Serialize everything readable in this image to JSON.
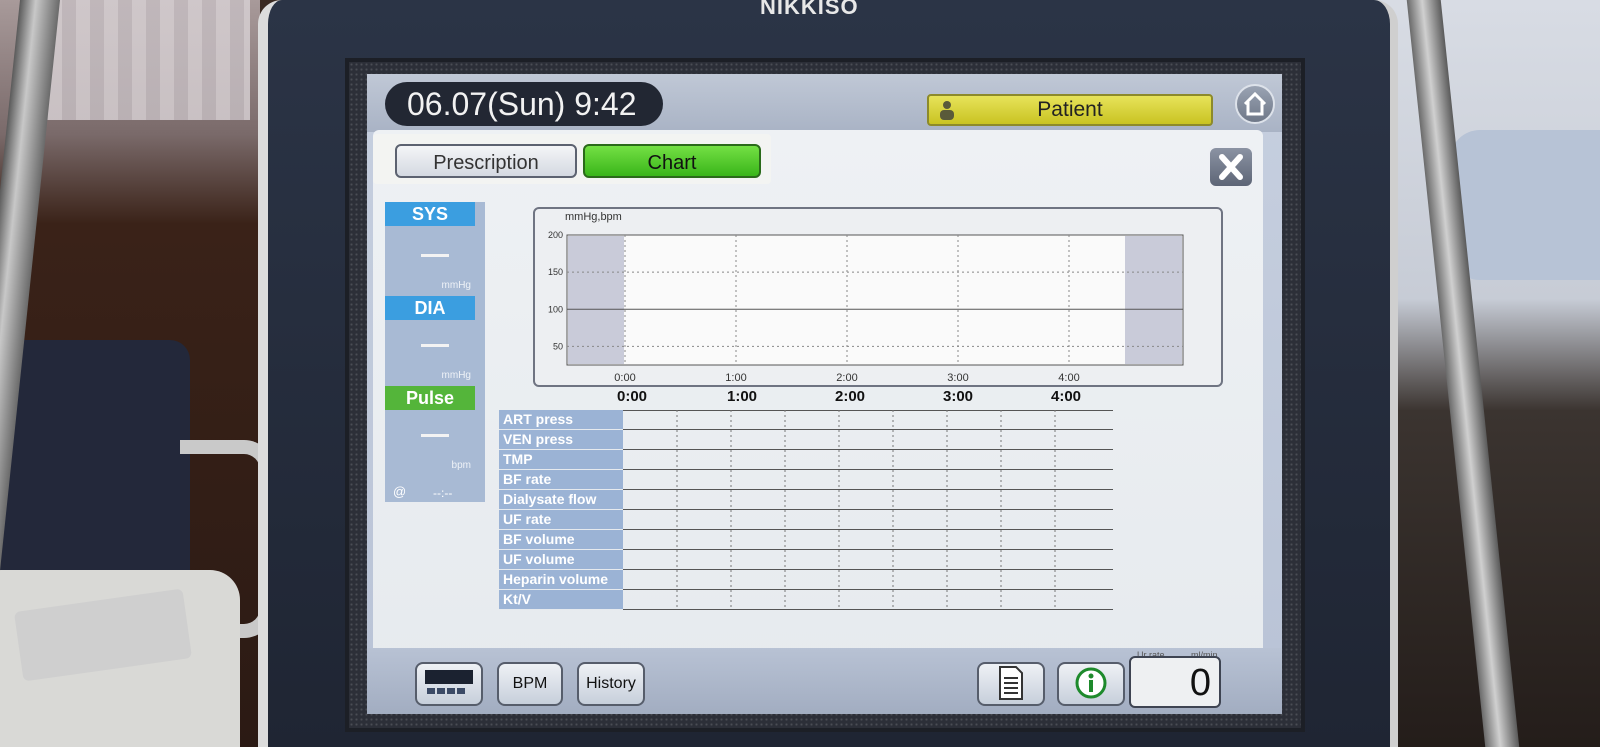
{
  "device": {
    "brand": "NIKKISO"
  },
  "header": {
    "datetime": "06.07(Sun)  9:42",
    "patient_label": "Patient"
  },
  "tabs": [
    {
      "label": "Prescription",
      "active": false
    },
    {
      "label": "Chart",
      "active": true
    }
  ],
  "vitals": {
    "sys_label": "SYS",
    "sys_value": "—",
    "sys_unit": "mmHg",
    "dia_label": "DIA",
    "dia_value": "—",
    "dia_unit": "mmHg",
    "pulse_label": "Pulse",
    "pulse_value": "—",
    "pulse_unit": "bpm",
    "at_symbol": "@",
    "measure_time": "--:--"
  },
  "chart_data": {
    "type": "line",
    "ylabel": "mmHg,bpm",
    "y_ticks": [
      "200",
      "150",
      "100",
      "50"
    ],
    "x_ticks": [
      "0:00",
      "1:00",
      "2:00",
      "3:00",
      "4:00"
    ],
    "ylim": [
      25,
      200
    ],
    "series": []
  },
  "table": {
    "time_headers": [
      "0:00",
      "1:00",
      "2:00",
      "3:00",
      "4:00"
    ],
    "rows": [
      "ART press",
      "VEN press",
      "TMP",
      "BF rate",
      "Dialysate flow",
      "UF rate",
      "BF volume",
      "UF volume",
      "Heparin volume",
      "Kt/V"
    ]
  },
  "bottom": {
    "bpm_label": "BPM",
    "history_label": "History",
    "counter_value": "0",
    "counter_caption_left": "Ur rate",
    "counter_caption_right": "ml/min"
  },
  "colors": {
    "tab_active": "#39b51a",
    "patient_button": "#d8d43c",
    "vital_label_blue": "#3b9ee0",
    "vital_label_green": "#54b53a"
  }
}
